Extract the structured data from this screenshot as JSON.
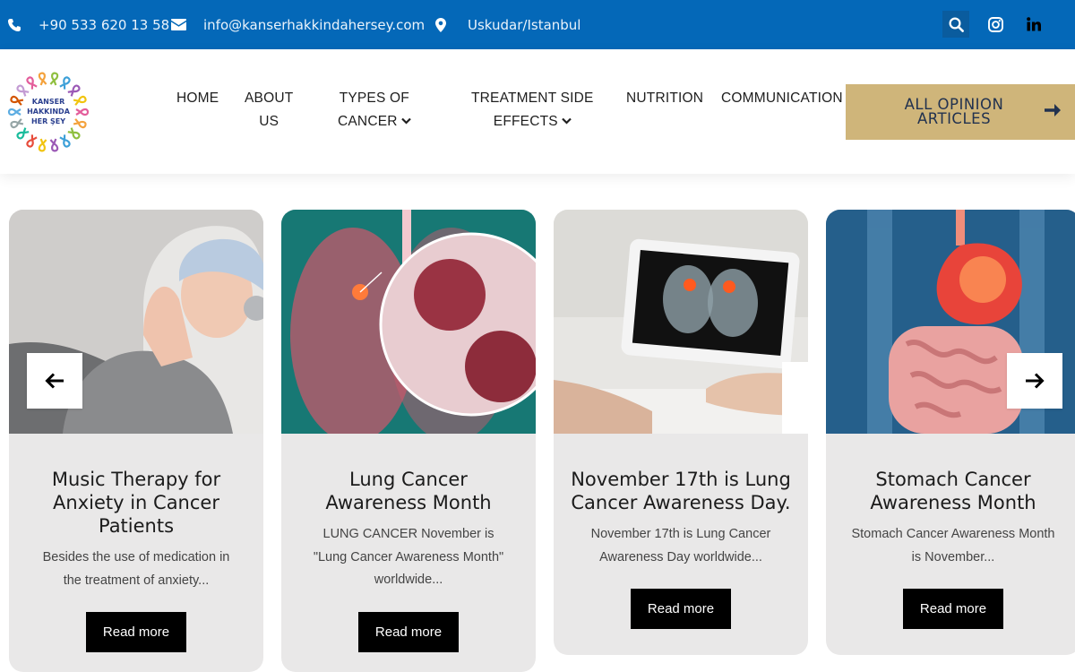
{
  "topbar": {
    "phone": "+90 533 620 13 58",
    "email": "info@kanserhakkindahersey.com",
    "location": "Uskudar/Istanbul",
    "icons": [
      "phone-icon",
      "envelope-icon",
      "map-pin-icon",
      "search-icon",
      "instagram-icon",
      "linkedin-icon"
    ]
  },
  "header": {
    "logo": {
      "line1": "KANSER",
      "line2": "HAKKINDA",
      "line3": "HER ŞEY"
    },
    "nav": [
      {
        "line1": "HOME",
        "line2": ""
      },
      {
        "line1": "ABOUT",
        "line2": "US"
      },
      {
        "line1": "TYPES OF",
        "line2": "CANCER"
      },
      {
        "line1": "TREATMENT SIDE",
        "line2": "EFFECTS"
      },
      {
        "line1": "NUTRITION",
        "line2": ""
      },
      {
        "line1": "COMMUNICATION",
        "line2": ""
      }
    ],
    "cta": {
      "line1": "ALL OPINION",
      "line2": "ARTICLES"
    }
  },
  "carousel": {
    "cards": [
      {
        "title": "Music Therapy for Anxiety in Cancer Patients",
        "excerpt": "Besides the use of medication in the treatment of anxiety...",
        "button": "Read more"
      },
      {
        "title": "Lung Cancer Awareness Month",
        "excerpt": "LUNG CANCER November is \"Lung Cancer Awareness Month\" worldwide...",
        "button": "Read more"
      },
      {
        "title": "November 17th is Lung Cancer Awareness Day.",
        "excerpt": "November 17th is Lung Cancer Awareness Day worldwide...",
        "button": "Read more"
      },
      {
        "title": "Stomach Cancer Awareness Month",
        "excerpt": "Stomach Cancer Awareness Month is November...",
        "button": "Read more"
      }
    ]
  },
  "colors": {
    "topbar": "#0468b8",
    "cta": "#cfb57a",
    "card": "#e9e8e8",
    "button": "#000000"
  }
}
